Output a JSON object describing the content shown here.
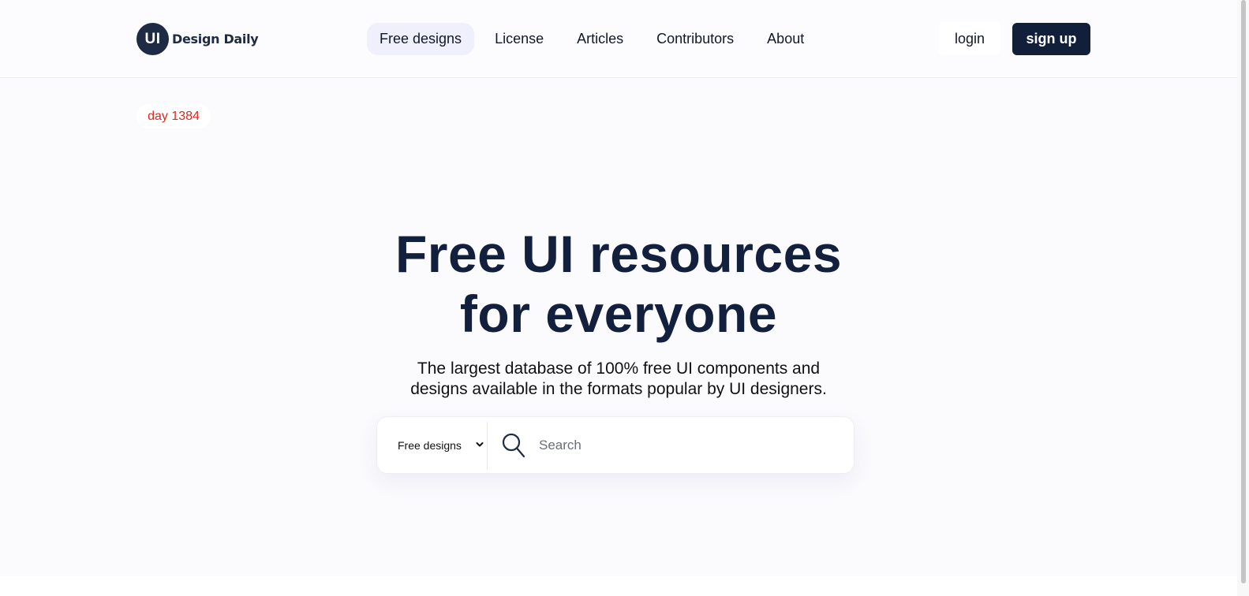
{
  "brand": {
    "badge": "UI",
    "name": "Design Daily"
  },
  "nav": {
    "items": [
      {
        "label": "Free designs",
        "active": true
      },
      {
        "label": "License",
        "active": false
      },
      {
        "label": "Articles",
        "active": false
      },
      {
        "label": "Contributors",
        "active": false
      },
      {
        "label": "About",
        "active": false
      }
    ]
  },
  "auth": {
    "login_label": "login",
    "signup_label": "sign up"
  },
  "day_badge": "day 1384",
  "hero": {
    "title_line1": "Free UI resources",
    "title_line2": "for everyone",
    "subtitle_line1": "The largest database of 100% free UI components and",
    "subtitle_line2": "designs available in the formats popular by UI designers."
  },
  "search": {
    "category_selected": "Free designs",
    "placeholder": "Search",
    "value": ""
  },
  "colors": {
    "brand_dark": "#111f3b",
    "accent_red": "#e0261e",
    "active_nav_bg": "#eff0fb",
    "page_bg": "#fbfbfe"
  },
  "icons": {
    "search": "search-icon",
    "select_caret": "chevron-down-icon"
  }
}
